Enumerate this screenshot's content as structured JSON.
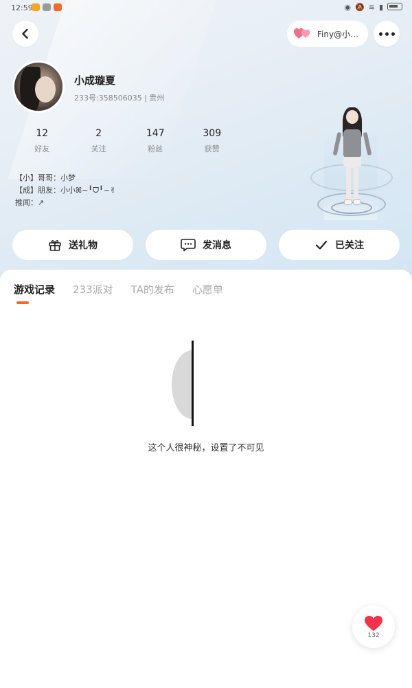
{
  "status_bar": {
    "time": "12:59",
    "icons": [
      "weibo-icon",
      "wechat-icon",
      "app-233-icon"
    ],
    "right_icons": [
      "eye-icon",
      "mute-icon",
      "wifi-icon",
      "alert-icon",
      "battery-icon"
    ]
  },
  "header": {
    "couple_tag": "Finy@小…",
    "accent_color": "#f06a2b"
  },
  "profile": {
    "nickname": "小成璇夏",
    "id_line": "233号:358506035 | 贵州",
    "stats": [
      {
        "value": "12",
        "label": "好友"
      },
      {
        "value": "2",
        "label": "关注"
      },
      {
        "value": "147",
        "label": "粉丝"
      },
      {
        "value": "309",
        "label": "获赞"
      }
    ],
    "bio": [
      "【小】哥哥：小梦",
      "【成】朋友：小小ꕤ~╹ᗜ╹~✌",
      "推闻：↗"
    ]
  },
  "actions": {
    "gift": "送礼物",
    "message": "发消息",
    "follow": "已关注"
  },
  "tabs": [
    {
      "label": "游戏记录",
      "active": true
    },
    {
      "label": "233派对",
      "active": false
    },
    {
      "label": "TA的发布",
      "active": false
    },
    {
      "label": "心愿单",
      "active": false
    }
  ],
  "empty_state": {
    "text": "这个人很神秘，设置了不可见"
  },
  "like": {
    "count": "132"
  }
}
